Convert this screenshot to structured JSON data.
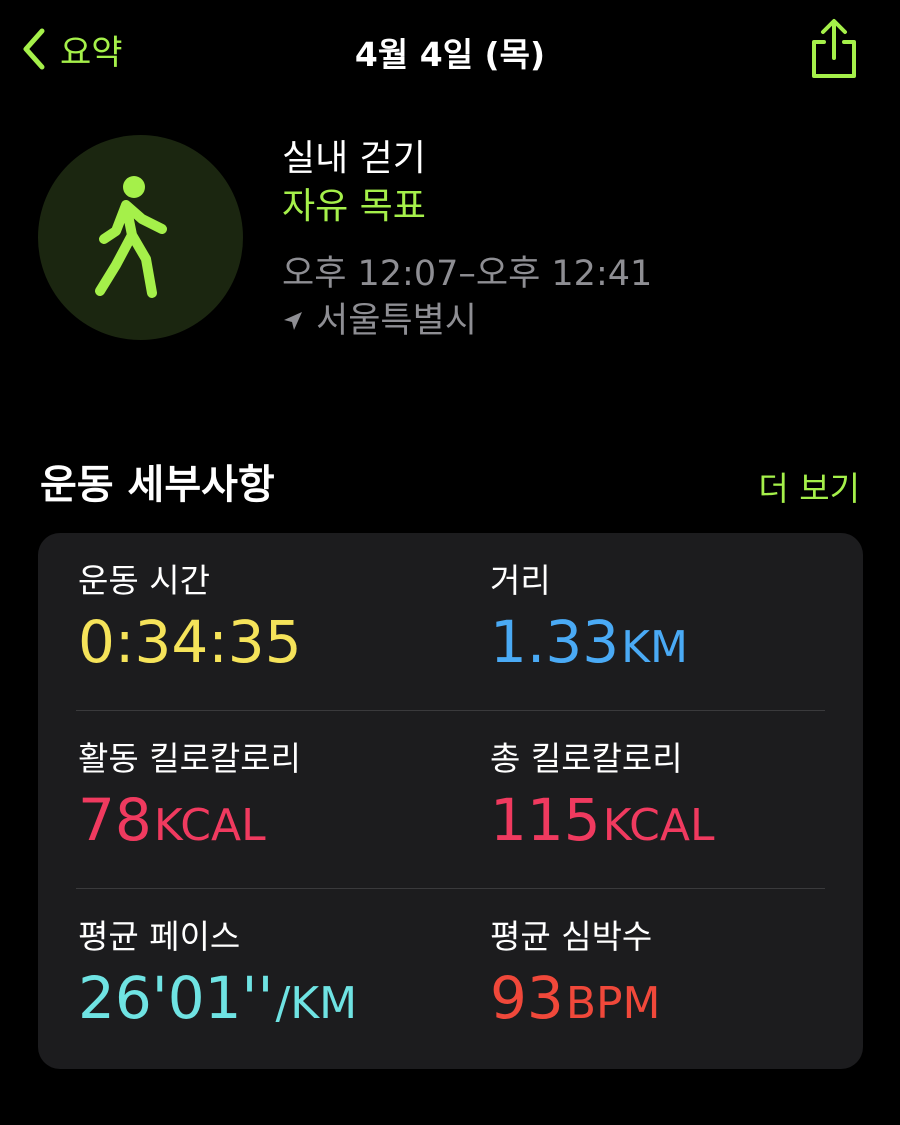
{
  "nav": {
    "back_label": "요약",
    "title": "4월 4일 (목)"
  },
  "workout": {
    "name": "실내 걷기",
    "goal": "자유 목표",
    "time_range": "오후 12:07–오후 12:41",
    "location": "서울특별시"
  },
  "details": {
    "title": "운동 세부사항",
    "more_label": "더 보기",
    "metrics": [
      {
        "label": "운동 시간",
        "value": "0:34:35",
        "unit": "",
        "color": "#f5e35a"
      },
      {
        "label": "거리",
        "value": "1.33",
        "unit": "KM",
        "color": "#4aaaf5"
      },
      {
        "label": "활동 킬로칼로리",
        "value": "78",
        "unit": "KCAL",
        "color": "#f03a5f"
      },
      {
        "label": "총 킬로칼로리",
        "value": "115",
        "unit": "KCAL",
        "color": "#f03a5f"
      },
      {
        "label": "평균 페이스",
        "value": "26'01''",
        "unit": "/KM",
        "color": "#6fe3e3"
      },
      {
        "label": "평균 심박수",
        "value": "93",
        "unit": "BPM",
        "color": "#f0483a"
      }
    ]
  },
  "colors": {
    "accent": "#a5f04a",
    "background": "#000000",
    "card": "#1c1c1e"
  }
}
